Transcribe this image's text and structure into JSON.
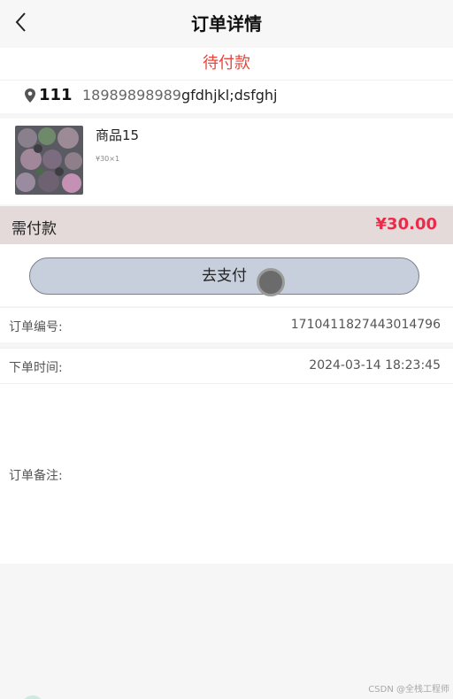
{
  "header": {
    "title": "订单详情",
    "back_icon": "chevron-left-icon"
  },
  "order": {
    "status": "待付款",
    "address": {
      "name": "111",
      "phone": "18989898989",
      "detail": "gfdhjkl;dsfghj",
      "icon": "location-pin-icon"
    },
    "product": {
      "name": "商品15",
      "spec": "¥30×1"
    },
    "payment": {
      "label": "需付款",
      "amount": "¥30.00"
    },
    "pay_button": "去支付",
    "info": {
      "number_label": "订单编号:",
      "number_value": "1710411827443014796",
      "time_label": "下单时间:",
      "time_value": "2024-03-14 18:23:45",
      "remark_label": "订单备注:"
    }
  },
  "watermark": "CSDN @全栈工程师",
  "colors": {
    "status": "#e8453c",
    "price": "#ee2a4a",
    "button_bg": "#c7cfdc",
    "pay_row_bg": "#e4dad9"
  }
}
